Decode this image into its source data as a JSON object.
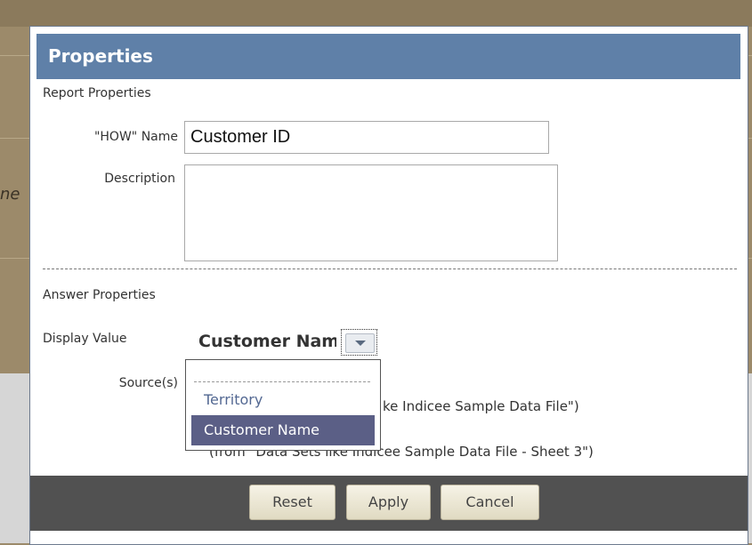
{
  "dialog": {
    "title": "Properties",
    "report_section": "Report Properties",
    "how_name_label": "\"HOW\" Name",
    "how_name_value": "Customer ID",
    "description_label": "Description",
    "description_value": "",
    "answer_section": "Answer Properties",
    "display_value_label": "Display Value",
    "display_value_selected": "Customer Name",
    "sources_label": "Source(s)",
    "sources": [
      "ke Indicee Sample Data File\")",
      "(from \"Data Sets like Indicee Sample Data File - Sheet 3\")"
    ],
    "dropdown_options": [
      "Territory",
      "Customer Name"
    ]
  },
  "footer": {
    "reset_label": "Reset",
    "apply_label": "Apply",
    "cancel_label": "Cancel"
  },
  "colors": {
    "title_bar": "#5f80a8",
    "selected_option": "#5b5f86",
    "footer": "#515151"
  },
  "background": {
    "fragment_text": "ne"
  }
}
